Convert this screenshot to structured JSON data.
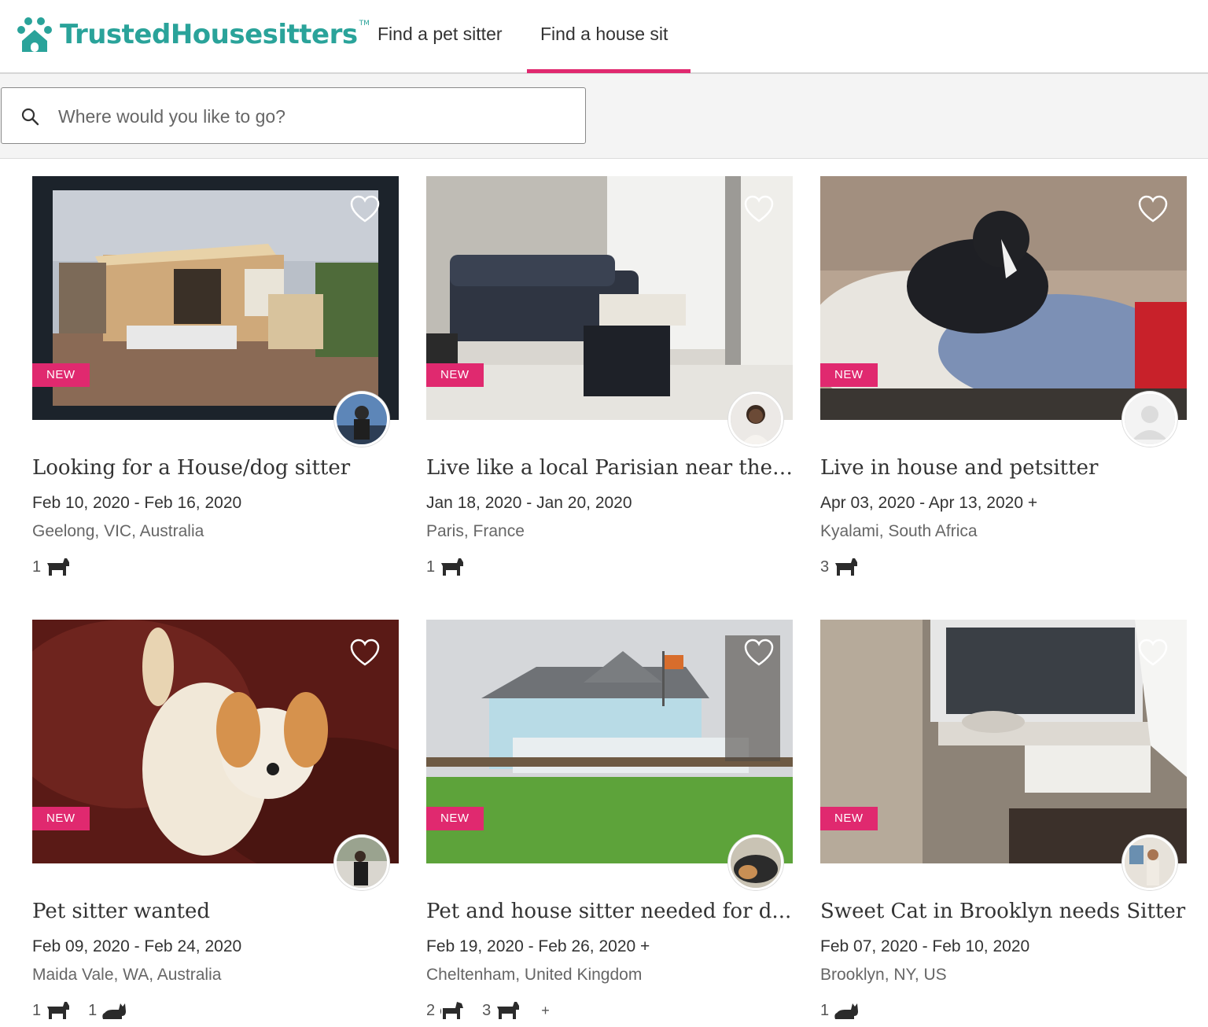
{
  "brand": {
    "name": "TrustedHousesitters",
    "tm": "TM",
    "color": "#2aa39a",
    "accent": "#e0296f"
  },
  "nav": {
    "find_sitter": "Find a pet sitter",
    "find_sit": "Find a house sit"
  },
  "search": {
    "placeholder": "Where would you like to go?"
  },
  "badge_label": "NEW",
  "listings": [
    {
      "title": "Looking for a House/dog sitter",
      "dates": "Feb 10, 2020 - Feb 16, 2020",
      "location": "Geelong, VIC, Australia",
      "pets": [
        {
          "count": "1",
          "icon": "dog-icon"
        }
      ],
      "more": ""
    },
    {
      "title": "Live like a local Parisian near the ...",
      "dates": "Jan 18, 2020 - Jan 20, 2020",
      "location": "Paris, France",
      "pets": [
        {
          "count": "1",
          "icon": "dog-icon"
        }
      ],
      "more": ""
    },
    {
      "title": "Live in house and petsitter",
      "dates": "Apr 03, 2020 - Apr 13, 2020 +",
      "location": "Kyalami, South Africa",
      "pets": [
        {
          "count": "3",
          "icon": "dog-icon"
        }
      ],
      "more": ""
    },
    {
      "title": "Pet sitter wanted",
      "dates": "Feb 09, 2020 - Feb 24, 2020",
      "location": "Maida Vale, WA, Australia",
      "pets": [
        {
          "count": "1",
          "icon": "dog-icon"
        },
        {
          "count": "1",
          "icon": "cat-icon"
        }
      ],
      "more": ""
    },
    {
      "title": "Pet and house sitter needed for d...",
      "dates": "Feb 19, 2020 - Feb 26, 2020 +",
      "location": "Cheltenham, United Kingdom",
      "pets": [
        {
          "count": "2",
          "icon": "horse-icon"
        },
        {
          "count": "3",
          "icon": "dog-icon"
        }
      ],
      "more": "+"
    },
    {
      "title": "Sweet Cat in Brooklyn needs Sitter",
      "dates": "Feb 07, 2020 - Feb 10, 2020",
      "location": "Brooklyn, NY, US",
      "pets": [
        {
          "count": "1",
          "icon": "cat-icon"
        }
      ],
      "more": ""
    }
  ]
}
